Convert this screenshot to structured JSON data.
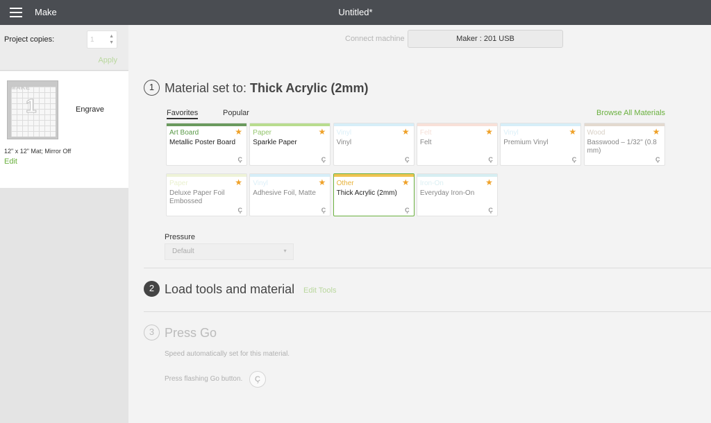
{
  "header": {
    "menu_label": "Make",
    "doc_title": "Untitled*"
  },
  "left": {
    "copies_label": "Project copies:",
    "copies_value": "1",
    "apply_label": "Apply",
    "mat_preview_text": "MAKE",
    "mat_number": "1",
    "operation": "Engrave",
    "mat_info": "12\" x 12\" Mat; Mirror Off",
    "edit_label": "Edit"
  },
  "connect": {
    "label": "Connect machine",
    "machine": "Maker : 201 USB"
  },
  "step1": {
    "number": "1",
    "title_prefix": "Material set to: ",
    "title_value": "Thick Acrylic (2mm)",
    "tabs": [
      "Favorites",
      "Popular"
    ],
    "browse_label": "Browse All Materials",
    "cards": [
      {
        "category": "Art Board",
        "name": "Metallic Poster Board",
        "color": "#6a9a5e",
        "cat_color": "#5a9a48",
        "faded": false,
        "selected": false
      },
      {
        "category": "Paper",
        "name": "Sparkle Paper",
        "color": "#b8dc8e",
        "cat_color": "#93c56b",
        "faded": false,
        "selected": false
      },
      {
        "category": "Vinyl",
        "name": "Vinyl",
        "color": "#d6eef8",
        "cat_color": "#bfe3f3",
        "faded": true,
        "selected": false
      },
      {
        "category": "Felt",
        "name": "Felt",
        "color": "#f8e0d8",
        "cat_color": "#eec6b6",
        "faded": true,
        "selected": false
      },
      {
        "category": "Vinyl",
        "name": "Premium Vinyl",
        "color": "#d6eef8",
        "cat_color": "#bfe3f3",
        "faded": true,
        "selected": false
      },
      {
        "category": "Wood",
        "name": "Basswood – 1/32\" (0.8 mm)",
        "color": "#e3d9cf",
        "cat_color": "#b8a996",
        "faded": true,
        "selected": false
      },
      {
        "category": "Paper",
        "name": "Deluxe Paper Foil Embossed",
        "color": "#eef3d8",
        "cat_color": "#d9e6a8",
        "faded": true,
        "selected": false
      },
      {
        "category": "Vinyl",
        "name": "Adhesive Foil, Matte",
        "color": "#d6eef8",
        "cat_color": "#bfe3f3",
        "faded": true,
        "selected": false
      },
      {
        "category": "Other",
        "name": "Thick Acrylic (2mm)",
        "color": "#efc451",
        "cat_color": "#e8b23a",
        "faded": false,
        "selected": true
      },
      {
        "category": "Iron-On",
        "name": "Everyday Iron-On",
        "color": "#d6eef2",
        "cat_color": "#bfe3ea",
        "faded": true,
        "selected": false
      }
    ],
    "pressure_label": "Pressure",
    "pressure_value": "Default"
  },
  "step2": {
    "number": "2",
    "title": "Load tools and material",
    "edit_tools": "Edit Tools"
  },
  "step3": {
    "number": "3",
    "title": "Press Go",
    "speed_text": "Speed automatically set for this material.",
    "press_text": "Press flashing Go button."
  },
  "icons": {
    "star": "star-icon",
    "go": "cricut-c-icon",
    "menu": "hamburger-icon"
  },
  "colors": {
    "accent": "#6ab03e",
    "topbar": "#4a4d52",
    "star": "#efa128"
  }
}
